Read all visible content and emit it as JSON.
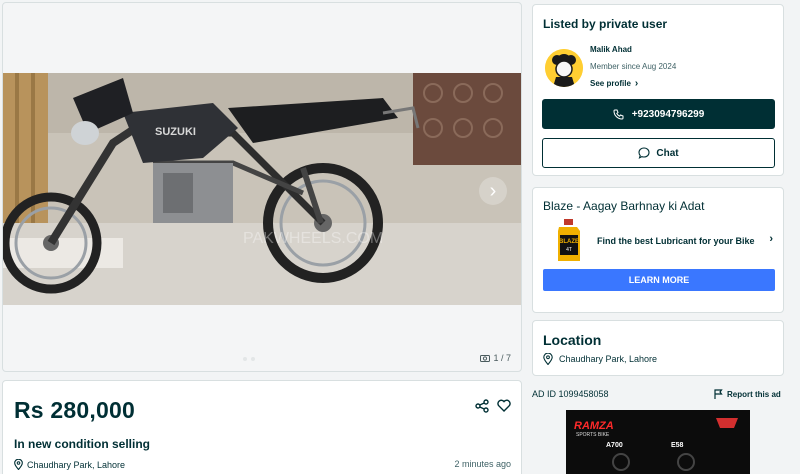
{
  "gallery": {
    "counter": "1 / 7",
    "watermark": "PAKWHEELS.COM"
  },
  "listing": {
    "price": "Rs 280,000",
    "title": "In new condition selling",
    "location": "Chaudhary Park, Lahore",
    "posted": "2 minutes ago"
  },
  "seller": {
    "heading": "Listed by private user",
    "name": "Malik Ahad",
    "member_since": "Member since Aug 2024",
    "see_profile": "See profile",
    "phone": "+923094796299",
    "chat": "Chat"
  },
  "ad": {
    "heading": "Blaze - Aagay Barhnay ki Adat",
    "text": "Find the best Lubricant for your Bike",
    "cta": "LEARN MORE",
    "bottle_label": "BLAZE",
    "bottle_sub": "4T"
  },
  "location_card": {
    "heading": "Location",
    "value": "Chaudhary Park, Lahore"
  },
  "footer": {
    "ad_id": "AD ID 1099458058",
    "report": "Report this ad"
  },
  "banner": {
    "brand": "RAMZA",
    "sub": "SPORTS BIKE",
    "model1": "A700",
    "model2": "E58"
  },
  "colors": {
    "primary": "#002f34",
    "accent": "#3a77ff",
    "avatar": "#ffce32"
  }
}
